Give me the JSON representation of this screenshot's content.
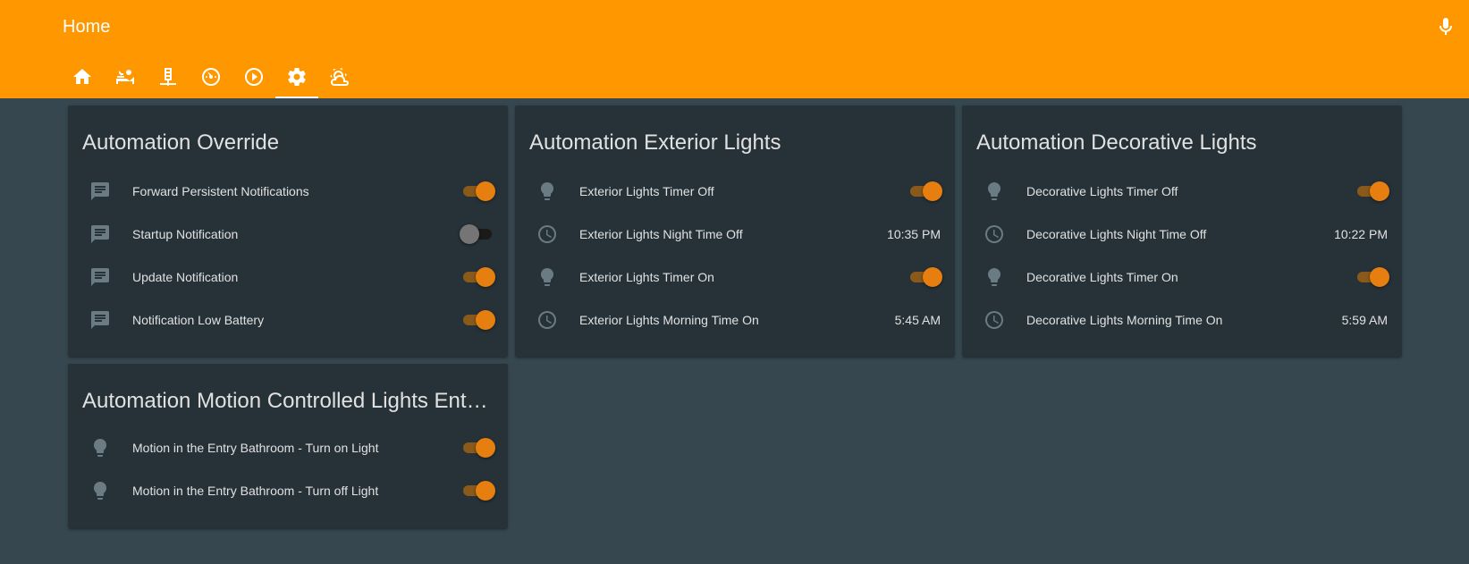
{
  "header": {
    "title": "Home",
    "tabs": [
      {
        "icon": "home-icon",
        "active": false
      },
      {
        "icon": "account-bed-icon",
        "active": false
      },
      {
        "icon": "server-network-icon",
        "active": false
      },
      {
        "icon": "speedometer-icon",
        "active": false
      },
      {
        "icon": "play-circle-icon",
        "active": false
      },
      {
        "icon": "settings-icon",
        "active": true
      },
      {
        "icon": "weather-partly-cloudy-icon",
        "active": false
      }
    ],
    "mic_icon": "microphone-icon"
  },
  "colors": {
    "accent": "#ff9800",
    "background": "#37474f",
    "card": "#263238",
    "toggle_on": "#e67e10",
    "icon": "#6b7b84"
  },
  "cards": [
    {
      "title": "Automation Override",
      "rows": [
        {
          "icon": "message-text-icon",
          "label": "Forward Persistent Notifications",
          "type": "toggle",
          "state": "on"
        },
        {
          "icon": "message-text-icon",
          "label": "Startup Notification",
          "type": "toggle",
          "state": "off"
        },
        {
          "icon": "message-text-icon",
          "label": "Update Notification",
          "type": "toggle",
          "state": "on"
        },
        {
          "icon": "message-text-icon",
          "label": "Notification Low Battery",
          "type": "toggle",
          "state": "on"
        }
      ]
    },
    {
      "title": "Automation Exterior Lights",
      "rows": [
        {
          "icon": "lightbulb-icon",
          "label": "Exterior Lights Timer Off",
          "type": "toggle",
          "state": "on"
        },
        {
          "icon": "clock-icon",
          "label": "Exterior Lights Night Time Off",
          "type": "value",
          "value": "10:35 PM"
        },
        {
          "icon": "lightbulb-icon",
          "label": "Exterior Lights Timer On",
          "type": "toggle",
          "state": "on"
        },
        {
          "icon": "clock-icon",
          "label": "Exterior Lights Morning Time On",
          "type": "value",
          "value": "5:45 AM"
        }
      ]
    },
    {
      "title": "Automation Decorative Lights",
      "rows": [
        {
          "icon": "lightbulb-icon",
          "label": "Decorative Lights Timer Off",
          "type": "toggle",
          "state": "on"
        },
        {
          "icon": "clock-icon",
          "label": "Decorative Lights Night Time Off",
          "type": "value",
          "value": "10:22 PM"
        },
        {
          "icon": "lightbulb-icon",
          "label": "Decorative Lights Timer On",
          "type": "toggle",
          "state": "on"
        },
        {
          "icon": "clock-icon",
          "label": "Decorative Lights Morning Time On",
          "type": "value",
          "value": "5:59 AM"
        }
      ]
    },
    {
      "title": "Automation Motion Controlled Lights Entry Bathroom",
      "rows": [
        {
          "icon": "lightbulb-icon",
          "label": "Motion in the Entry Bathroom - Turn on Light",
          "type": "toggle",
          "state": "on"
        },
        {
          "icon": "lightbulb-icon",
          "label": "Motion in the Entry Bathroom - Turn off Light",
          "type": "toggle",
          "state": "on"
        }
      ]
    }
  ]
}
